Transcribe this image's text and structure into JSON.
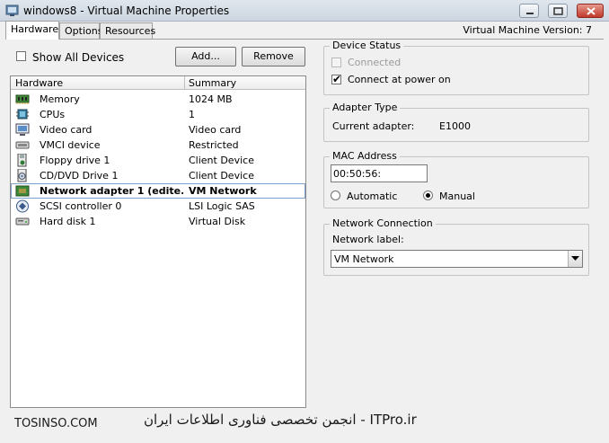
{
  "window": {
    "title": "windows8 - Virtual Machine Properties",
    "version": "Virtual Machine Version: 7"
  },
  "tabs": [
    {
      "label": "Hardware",
      "active": true
    },
    {
      "label": "Options",
      "active": false
    },
    {
      "label": "Resources",
      "active": false
    }
  ],
  "toolbar": {
    "show_all_label": "Show All Devices",
    "show_all_checked": false,
    "add_label": "Add...",
    "remove_label": "Remove"
  },
  "hardware_table": {
    "columns": [
      "Hardware",
      "Summary"
    ],
    "rows": [
      {
        "name": "Memory",
        "summary": "1024 MB",
        "icon": "memory-icon"
      },
      {
        "name": "CPUs",
        "summary": "1",
        "icon": "cpu-icon"
      },
      {
        "name": "Video card",
        "summary": "Video card",
        "icon": "monitor-icon"
      },
      {
        "name": "VMCI device",
        "summary": "Restricted",
        "icon": "vmci-icon"
      },
      {
        "name": "Floppy drive 1",
        "summary": "Client Device",
        "icon": "floppy-icon"
      },
      {
        "name": "CD/DVD Drive 1",
        "summary": "Client Device",
        "icon": "cd-drive-icon"
      },
      {
        "name": "Network adapter 1 (edite...",
        "summary": "VM Network",
        "icon": "network-adapter-icon",
        "selected": true
      },
      {
        "name": "SCSI controller 0",
        "summary": "LSI Logic SAS",
        "icon": "scsi-icon"
      },
      {
        "name": "Hard disk 1",
        "summary": "Virtual Disk",
        "icon": "hard-disk-icon"
      }
    ]
  },
  "device_status": {
    "legend": "Device Status",
    "connected_label": "Connected",
    "connected_checked": false,
    "connect_power_label": "Connect at power on",
    "connect_power_checked": true
  },
  "adapter_type": {
    "legend": "Adapter Type",
    "current_label": "Current adapter:",
    "current_value": "E1000"
  },
  "mac_address": {
    "legend": "MAC Address",
    "value": "00:50:56:",
    "automatic_label": "Automatic",
    "manual_label": "Manual",
    "selected": "manual"
  },
  "network_connection": {
    "legend": "Network Connection",
    "label": "Network label:",
    "selected_value": "VM Network"
  },
  "watermark": {
    "left": "TOSINSO.COM",
    "right": "ITPro.ir - انجمن تخصصی فناوری اطلاعات ایران"
  },
  "colors": {
    "selection_outline": "#7da2ce",
    "close_button": "#c0392b"
  }
}
